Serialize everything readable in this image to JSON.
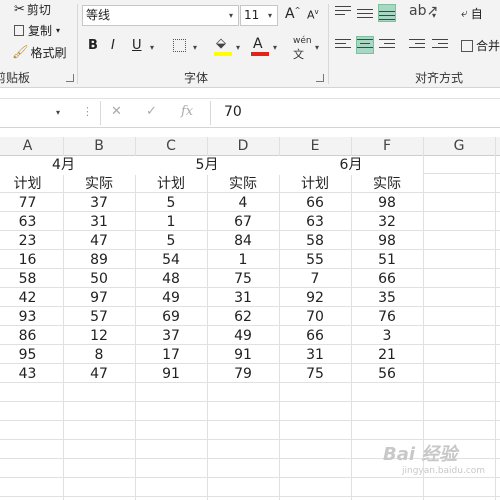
{
  "ribbon": {
    "clipboard": {
      "cut_label": "剪切",
      "copy_label": "复制",
      "format_painter_label": "格式刷",
      "group_label": "剪贴板"
    },
    "font": {
      "font_name": "等线",
      "font_size": "11",
      "grow_label": "A",
      "shrink_label": "A",
      "bold_label": "B",
      "italic_label": "I",
      "underline_label": "U",
      "phonetic_label": "wén",
      "font_color_label": "A",
      "group_label": "字体",
      "accent_font_color": "#e2231a",
      "accent_fill_color": "#ffff00"
    },
    "alignment": {
      "wrap_label": "自",
      "merge_label": "合并",
      "group_label": "对齐方式",
      "selected_color": "#a8d8c4"
    }
  },
  "formula_bar": {
    "cancel_icon": "✕",
    "enter_icon": "✓",
    "fx_label": "fx",
    "value": "70"
  },
  "sheet": {
    "columns": [
      "A",
      "B",
      "C",
      "D",
      "E",
      "F",
      "G"
    ],
    "month_headers": [
      "4月",
      "5月",
      "6月"
    ],
    "sub_headers": [
      "计划",
      "实际",
      "计划",
      "实际",
      "计划",
      "实际"
    ],
    "rows": [
      [
        "77",
        "37",
        "5",
        "4",
        "66",
        "98"
      ],
      [
        "63",
        "31",
        "1",
        "67",
        "63",
        "32"
      ],
      [
        "23",
        "47",
        "5",
        "84",
        "58",
        "98"
      ],
      [
        "16",
        "89",
        "54",
        "1",
        "55",
        "51"
      ],
      [
        "58",
        "50",
        "48",
        "75",
        "7",
        "66"
      ],
      [
        "42",
        "97",
        "49",
        "31",
        "92",
        "35"
      ],
      [
        "93",
        "57",
        "69",
        "62",
        "70",
        "76"
      ],
      [
        "86",
        "12",
        "37",
        "49",
        "66",
        "3"
      ],
      [
        "95",
        "8",
        "17",
        "91",
        "31",
        "21"
      ],
      [
        "43",
        "47",
        "91",
        "79",
        "75",
        "56"
      ]
    ]
  },
  "watermark": {
    "brand": "Bai 经验",
    "sub": "jingyan.baidu.com"
  }
}
